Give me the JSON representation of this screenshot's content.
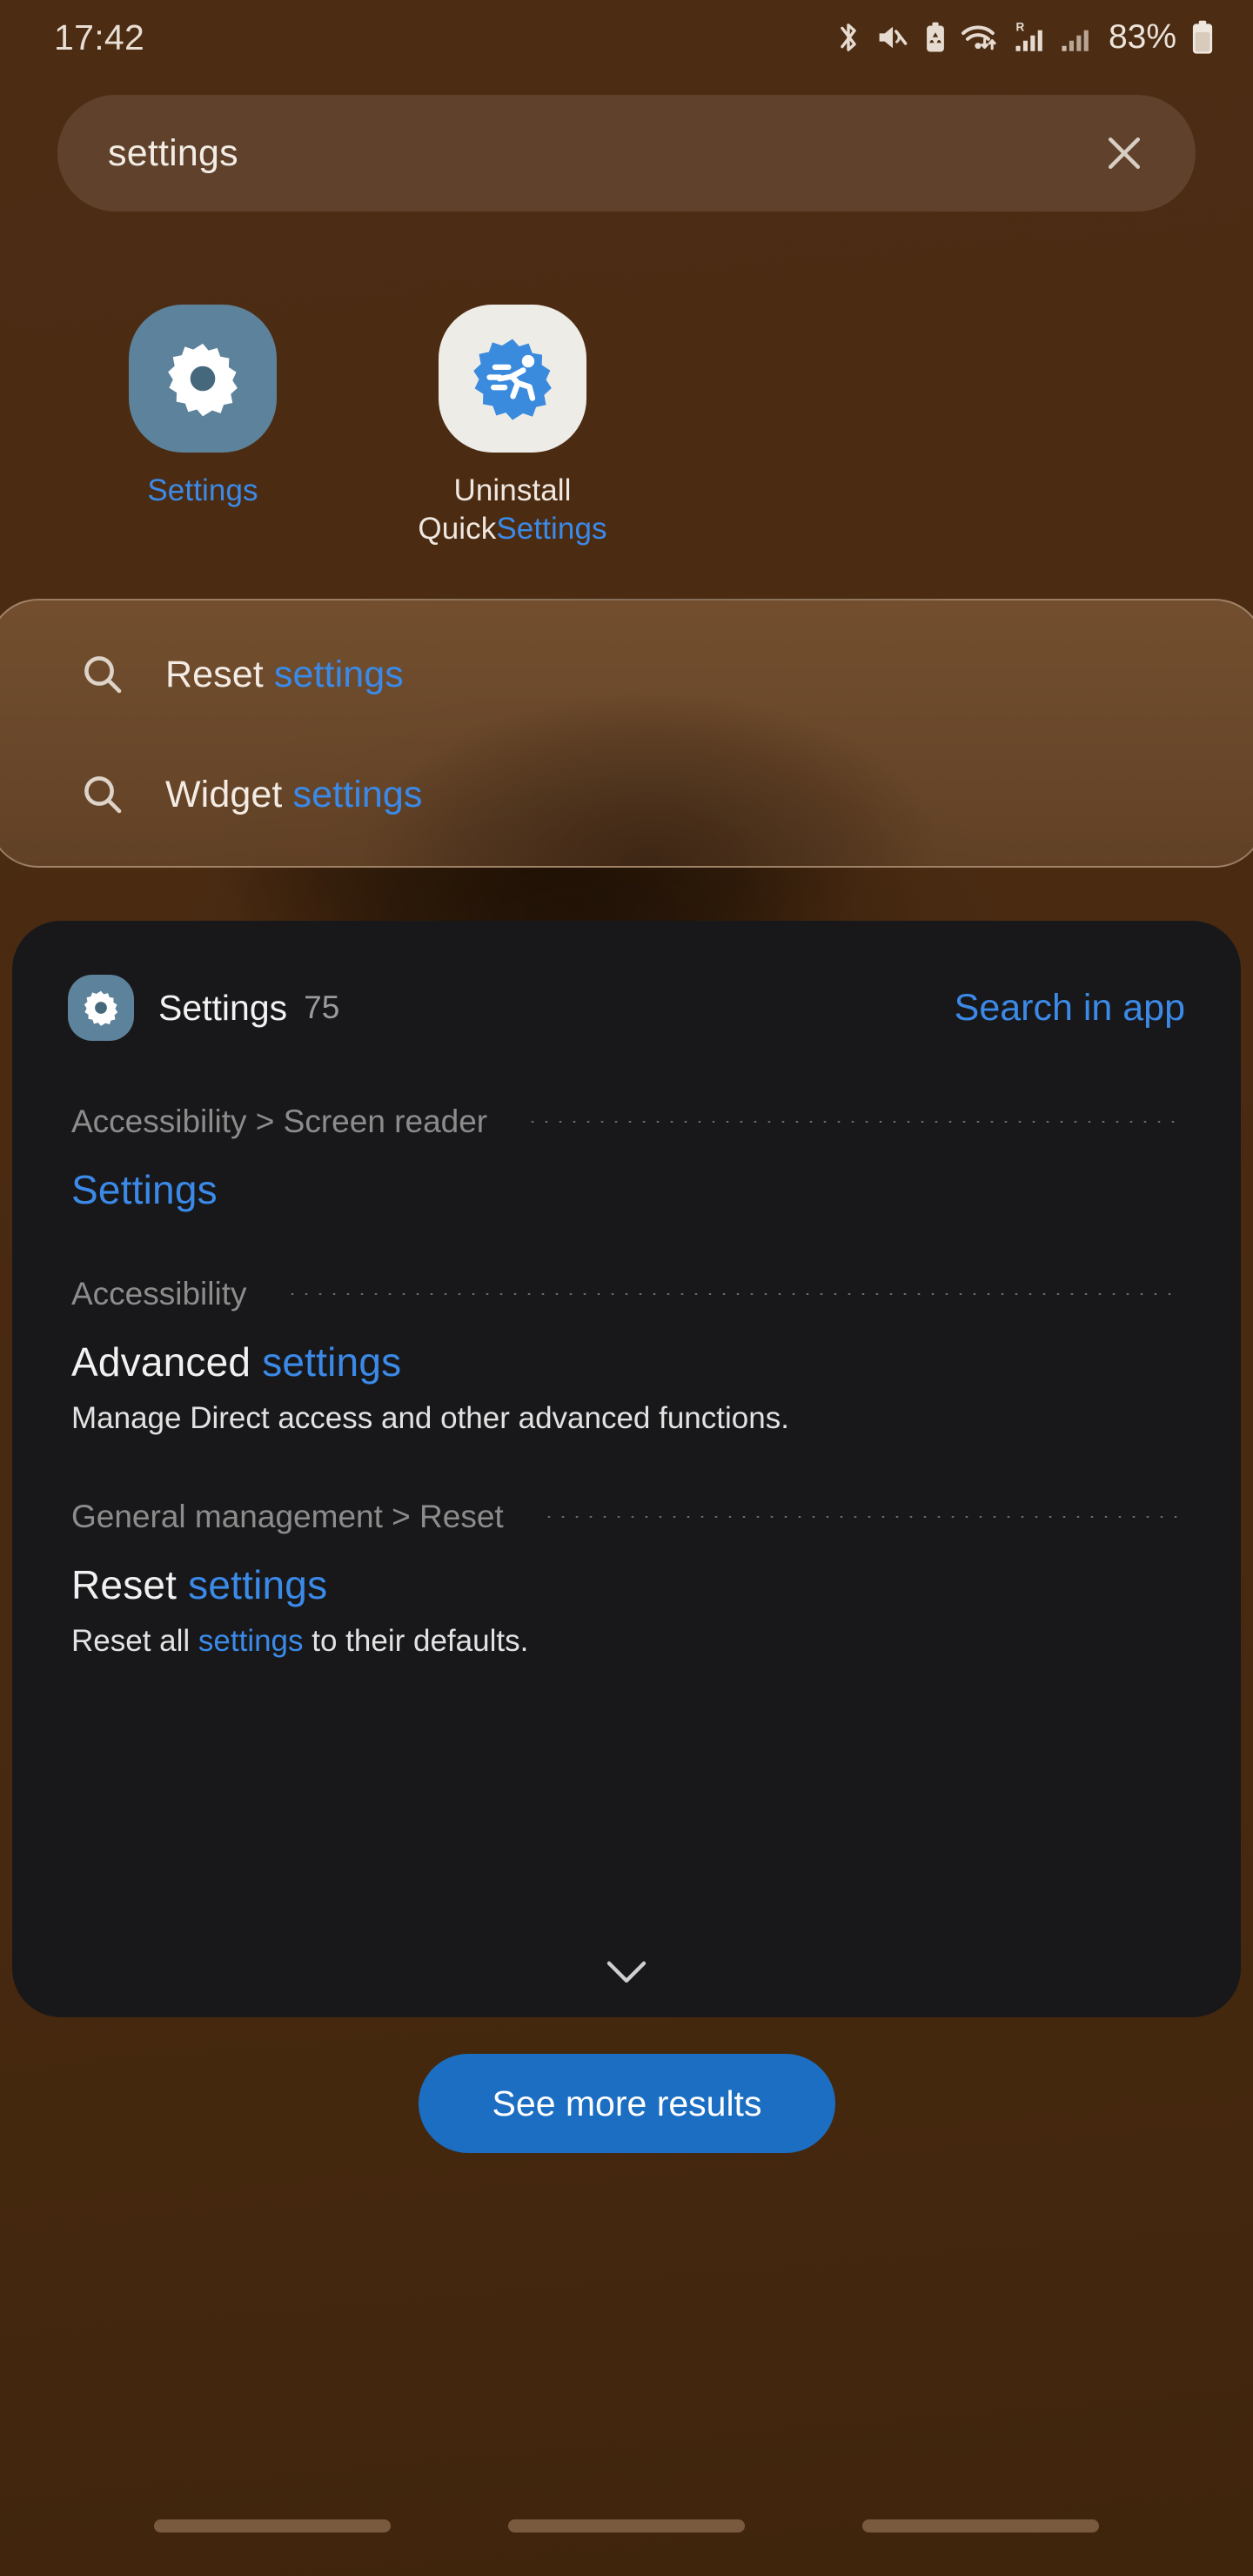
{
  "statusbar": {
    "clock": "17:42",
    "battery_percent": "83%",
    "icons": [
      "bluetooth-icon",
      "volume-mute-icon",
      "battery-saver-icon",
      "wifi-data-icon",
      "signal-roaming-icon",
      "signal-bars-icon",
      "battery-icon"
    ]
  },
  "search": {
    "value": "settings",
    "placeholder": "Search",
    "clear_icon": "close-icon"
  },
  "apps": [
    {
      "label_plain": "",
      "label_highlight": "Settings",
      "icon": "settings-gear-icon",
      "icon_bg": "#5d829c"
    },
    {
      "label_plain": "Uninstall Quick",
      "label_highlight": "Settings",
      "icon": "quick-settings-icon",
      "icon_bg": "#eeece7"
    }
  ],
  "suggestions": [
    {
      "icon": "search-icon",
      "plain": "Reset ",
      "highlight": "settings"
    },
    {
      "icon": "search-icon",
      "plain": "Widget ",
      "highlight": "settings"
    }
  ],
  "results_card": {
    "app_icon": "settings-gear-icon",
    "app_name": "Settings",
    "result_count": "75",
    "search_in_app_label": "Search in app",
    "expand_icon": "chevron-down-icon",
    "items": [
      {
        "breadcrumb": "Accessibility > Screen reader",
        "title_plain": "",
        "title_highlight": "Settings",
        "title_tail": "",
        "desc_before": "",
        "desc_highlight": "",
        "desc_after": ""
      },
      {
        "breadcrumb": "Accessibility",
        "title_plain": "Advanced ",
        "title_highlight": "settings",
        "title_tail": "",
        "desc_before": "Manage Direct access and other advanced functions.",
        "desc_highlight": "",
        "desc_after": ""
      },
      {
        "breadcrumb": "General management > Reset",
        "title_plain": "Reset ",
        "title_highlight": "settings",
        "title_tail": "",
        "desc_before": "Reset all ",
        "desc_highlight": "settings",
        "desc_after": " to their defaults."
      }
    ]
  },
  "see_more": {
    "label": "See more results"
  },
  "navbar": {
    "handles": [
      "nav-handle-recents",
      "nav-handle-home",
      "nav-handle-back"
    ]
  },
  "colors": {
    "background": "#4a2c13",
    "searchbar": "#60422c",
    "card": "#18181a",
    "accent_blue": "#3b8ae8",
    "button_blue": "#1b6ec2",
    "muted_text": "#8c8c8c"
  }
}
